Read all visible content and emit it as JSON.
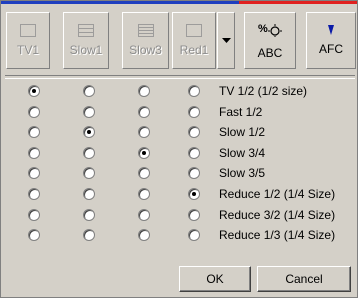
{
  "toolbar": {
    "buttons": [
      {
        "label": "TV1",
        "icon": "single-pane-icon",
        "enabled": false
      },
      {
        "label": "Slow1",
        "icon": "split-pane-icon",
        "enabled": false
      },
      {
        "label": "Slow3",
        "icon": "multi-split-pane-icon",
        "enabled": false
      },
      {
        "label": "Red1",
        "icon": "single-pane-icon",
        "enabled": false
      }
    ],
    "dropdown_icon": "triangle-down-icon",
    "abc": {
      "label": "ABC",
      "icon": "abc-settings-icon"
    },
    "afc": {
      "label": "AFC",
      "icon": "triangle-down-icon"
    }
  },
  "columns": [
    "TV1",
    "Slow1",
    "Slow3",
    "Red1"
  ],
  "modes": [
    {
      "label": "TV 1/2 (1/2 size)",
      "selected_column": 0
    },
    {
      "label": "Fast 1/2",
      "selected_column": null
    },
    {
      "label": "Slow 1/2",
      "selected_column": 1
    },
    {
      "label": "Slow 3/4",
      "selected_column": 2
    },
    {
      "label": "Slow 3/5",
      "selected_column": null
    },
    {
      "label": "Reduce 1/2 (1/4 Size)",
      "selected_column": 3
    },
    {
      "label": "Reduce 3/2 (1/4 Size)",
      "selected_column": null
    },
    {
      "label": "Reduce 1/3 (1/4 Size)",
      "selected_column": null
    }
  ],
  "dialog": {
    "ok_label": "OK",
    "cancel_label": "Cancel"
  },
  "colors": {
    "top_stripe_left": "#1f3fbf",
    "top_stripe_right": "#e0211f",
    "afc_arrow": "#0a1aa8"
  }
}
